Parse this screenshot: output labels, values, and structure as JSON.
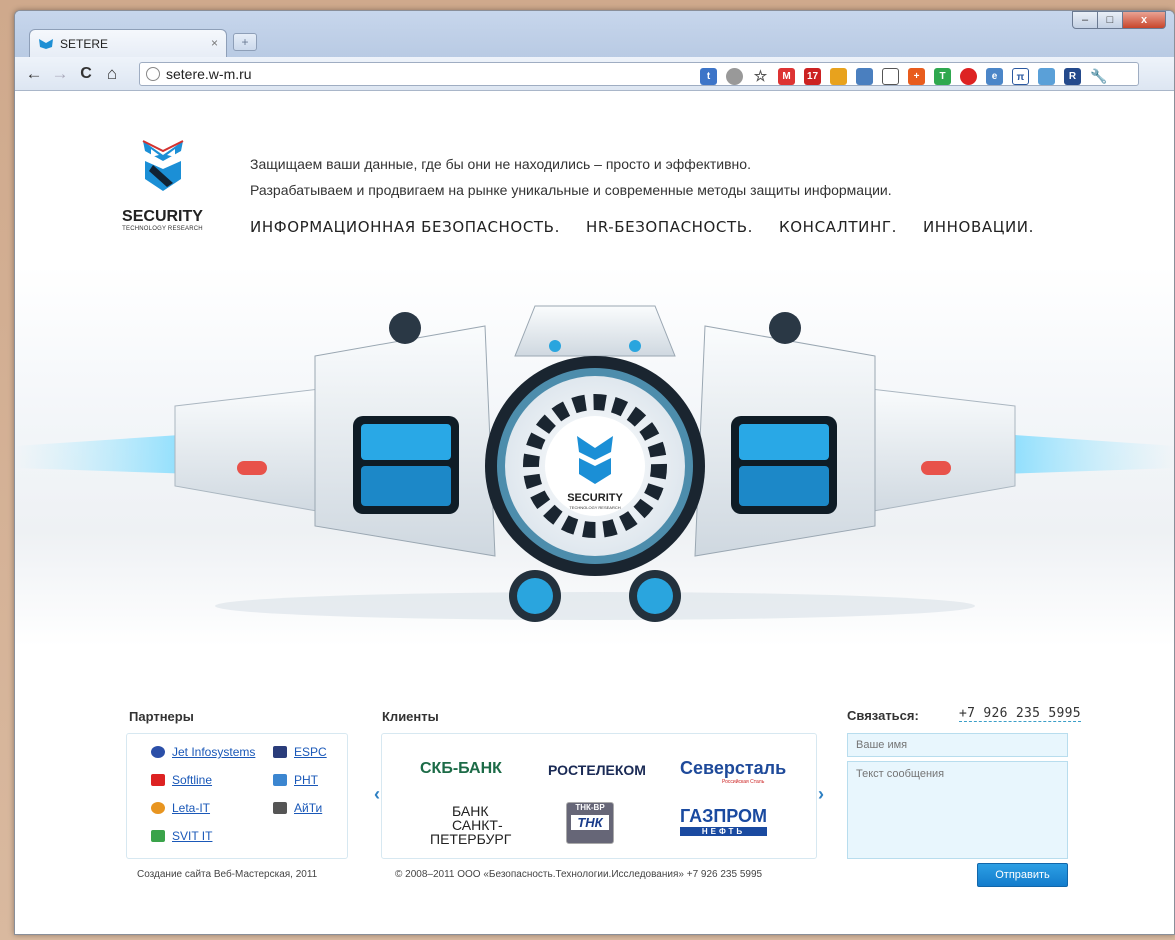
{
  "browser": {
    "tab_title": "SETERE",
    "tab_close": "×",
    "new_tab": "+",
    "url": "setere.w-m.ru",
    "window_buttons": {
      "minimize": "–",
      "maximize": "□",
      "close": "x"
    },
    "nav": {
      "back": "←",
      "forward": "→",
      "reload": "C",
      "home": "⌂"
    },
    "extensions": [
      "bookmark-icon",
      "lightbulb-icon",
      "star-icon",
      "gmail-icon",
      "calendar-icon",
      "cards-icon",
      "people-icon",
      "keyboard-icon",
      "plus-icon",
      "t-icon",
      "record-icon",
      "ie-icon",
      "pi-icon",
      "feather-icon",
      "r-icon",
      "wrench-icon"
    ]
  },
  "logo": {
    "name": "SECURITY",
    "subtitle": "TECHNOLOGY RESEARCH"
  },
  "tagline": {
    "line1": "Защищаем ваши данные, где бы они не находились – просто и эффективно.",
    "line2": "Разрабатываем и продвигаем на рынке уникальные и современные методы защиты информации."
  },
  "menu": [
    "ИНФОРМАЦИОННАЯ БЕЗОПАСНОСТЬ.",
    "HR-БЕЗОПАСНОСТЬ.",
    "КОНСАЛТИНГ.",
    "ИННОВАЦИИ."
  ],
  "hero": {
    "badge_name": "SECURITY",
    "badge_subtitle": "TECHNOLOGY RESEARCH"
  },
  "partners": {
    "title": "Партнеры",
    "col1": [
      "Jet Infosystems",
      "Softline",
      "Leta-IT",
      "SVIT IT"
    ],
    "col2": [
      "ESPC",
      "РНТ",
      "АйТи"
    ],
    "footer": "Создание сайта Веб-Мастерская, 2011"
  },
  "clients": {
    "title": "Клиенты",
    "logos": [
      "СКБ-БАНК",
      "РОСТЕЛЕКОМ",
      "Северсталь",
      "Российская Сталь",
      "БАНК",
      "САНКТ-",
      "ПЕТЕРБУРГ",
      "ТНК-ВР",
      "ТНК",
      "ГАЗПРОМ",
      "НЕФТЬ"
    ],
    "footer": "© 2008–2011 ООО «Безопасность.Технологии.Исследования» +7 926 235 5995",
    "prev": "‹",
    "next": "›"
  },
  "contact": {
    "title": "Связаться:",
    "phone": "+7 926 235 5995",
    "name_placeholder": "Ваше имя",
    "message_placeholder": "Текст сообщения",
    "send": "Отправить"
  }
}
